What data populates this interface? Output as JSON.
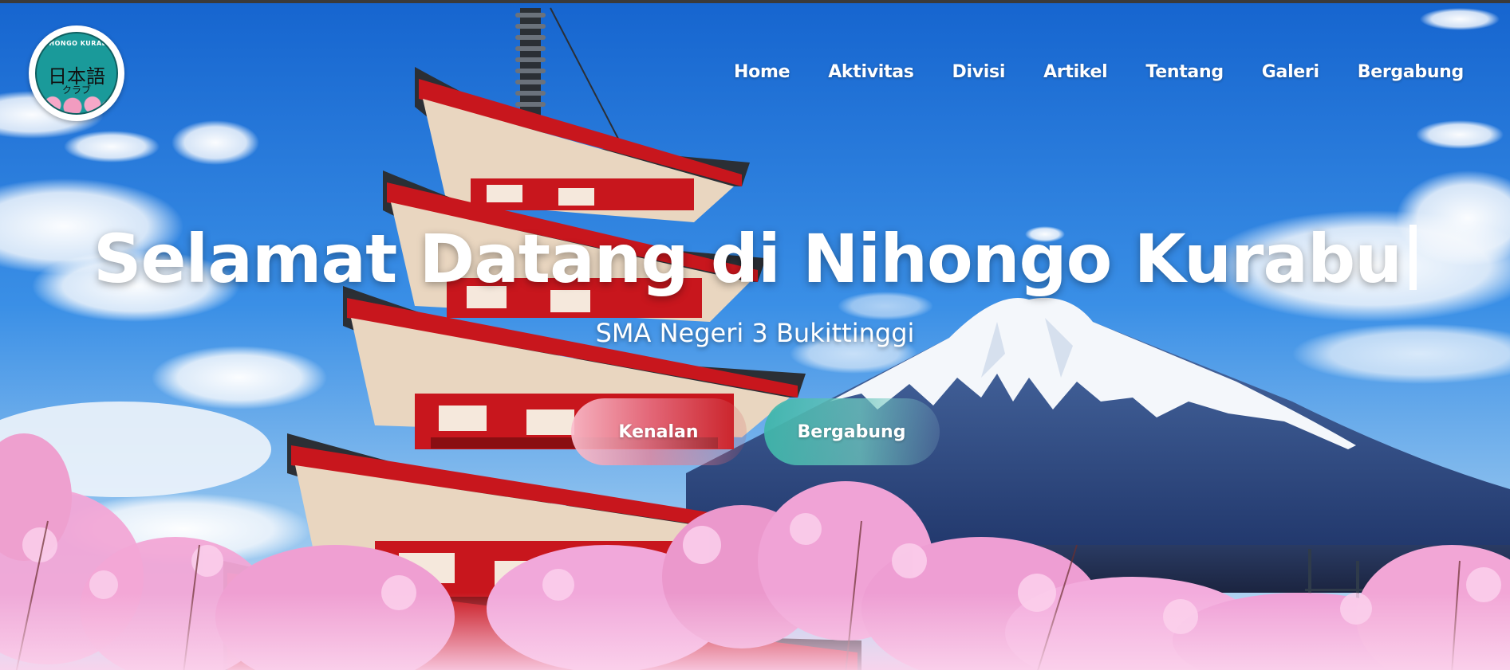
{
  "logo": {
    "ring_text": "NIHONGO KURABU",
    "kanji": "日本語",
    "kana": "クラブ"
  },
  "nav": {
    "items": [
      {
        "label": "Home"
      },
      {
        "label": "Aktivitas"
      },
      {
        "label": "Divisi"
      },
      {
        "label": "Artikel"
      },
      {
        "label": "Tentang"
      },
      {
        "label": "Galeri"
      },
      {
        "label": "Bergabung"
      }
    ]
  },
  "hero": {
    "headline": "Selamat Datang di Nihongo Kurabu",
    "subtitle": "SMA Negeri 3 Bukittinggi",
    "primary_button": "Kenalan",
    "secondary_button": "Bergabung"
  },
  "background": {
    "scene": "pagoda-mount-fuji-cherry-blossom"
  },
  "colors": {
    "sky": "#1f7fe0",
    "pagoda_red": "#c8161d",
    "blossom_pink": "#f2a2d0",
    "primary_button": "#f3a7bb",
    "secondary_button": "#45b6aa"
  }
}
